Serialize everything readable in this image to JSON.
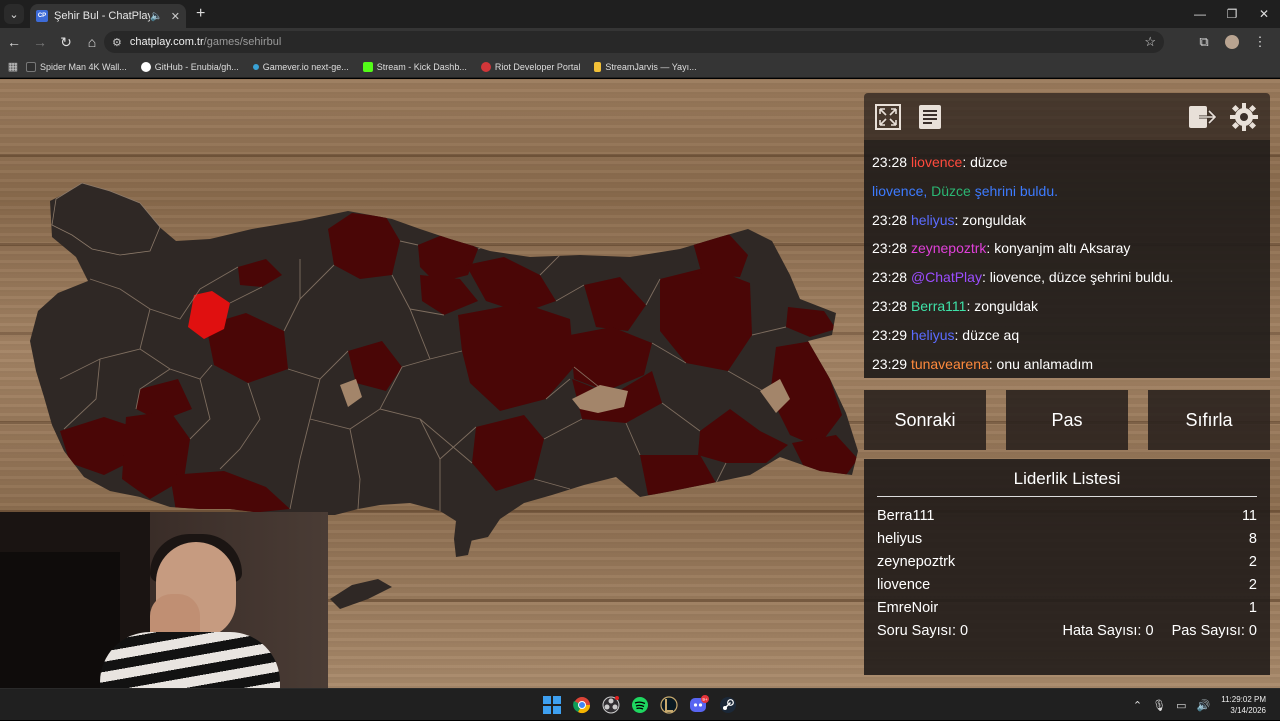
{
  "browser": {
    "tab_title": "Şehir Bul - ChatPlay",
    "tab_favicon": "CP",
    "url_host": "chatplay.com.tr",
    "url_path": "/games/sehirbul",
    "bookmarks": [
      {
        "label": "Spider Man 4K Wall...",
        "icon": "4K",
        "color": "#2e2e2e"
      },
      {
        "label": "GitHub - Enubia/gh...",
        "icon": "github-icon",
        "color": "#ffffff"
      },
      {
        "label": "Gamever.io next-ge...",
        "icon": "gamever-icon",
        "color": "#39a1d4"
      },
      {
        "label": "Stream - Kick Dashb...",
        "icon": "kick-icon",
        "color": "#53fc18"
      },
      {
        "label": "Riot Developer Portal",
        "icon": "riot-icon",
        "color": "#d13639"
      },
      {
        "label": "StreamJarvis — Yayı...",
        "icon": "streamjarvis-icon",
        "color": "#f2c037"
      }
    ]
  },
  "chat": {
    "messages": [
      {
        "time": "23:28",
        "user": "liovence",
        "color": "#ff4a3d",
        "text": ": düzce"
      },
      {
        "time": "",
        "user": "",
        "color": "",
        "system": true,
        "parts": [
          {
            "text": "liovence, ",
            "color": "#3d7bff"
          },
          {
            "text": "Düzce",
            "color": "#2bb673"
          },
          {
            "text": " şehrini buldu.",
            "color": "#3d7bff"
          }
        ]
      },
      {
        "time": "23:28",
        "user": "heliyus",
        "color": "#5b6cff",
        "text": ": zonguldak"
      },
      {
        "time": "23:28",
        "user": "zeynepoztrk",
        "color": "#e040d9",
        "text": ": konyanjm altı Aksaray"
      },
      {
        "time": "23:28",
        "user": "@ChatPlay",
        "color": "#9b4dff",
        "text": ": liovence, düzce şehrini buldu."
      },
      {
        "time": "23:28",
        "user": "Berra111",
        "color": "#3ee2a8",
        "text": ": zonguldak"
      },
      {
        "time": "23:29",
        "user": "heliyus",
        "color": "#5b6cff",
        "text": ": düzce aq"
      },
      {
        "time": "23:29",
        "user": "tunavearena",
        "color": "#ff8a3d",
        "text": ": onu anlamadım"
      }
    ]
  },
  "controls": {
    "next": "Sonraki",
    "pass": "Pas",
    "reset": "Sıfırla"
  },
  "leaderboard": {
    "title": "Liderlik Listesi",
    "rows": [
      {
        "name": "Berra111",
        "score": "11"
      },
      {
        "name": "heliyus",
        "score": "8"
      },
      {
        "name": "zeynepoztrk",
        "score": "2"
      },
      {
        "name": "liovence",
        "score": "2"
      },
      {
        "name": "EmreNoir",
        "score": "1"
      }
    ],
    "stats": {
      "questions": "Soru Sayısı: 0",
      "errors": "Hata Sayısı: 0",
      "passes": "Pas Sayısı: 0"
    }
  },
  "taskbar": {
    "time": "11:29:02 PM",
    "date": "3/14/2026",
    "discord_badge": "9+"
  },
  "colors": {
    "province_default": "#2f2825",
    "province_found": "#4a0606",
    "province_active": "#e01010",
    "province_border": "#8c7a6a"
  }
}
